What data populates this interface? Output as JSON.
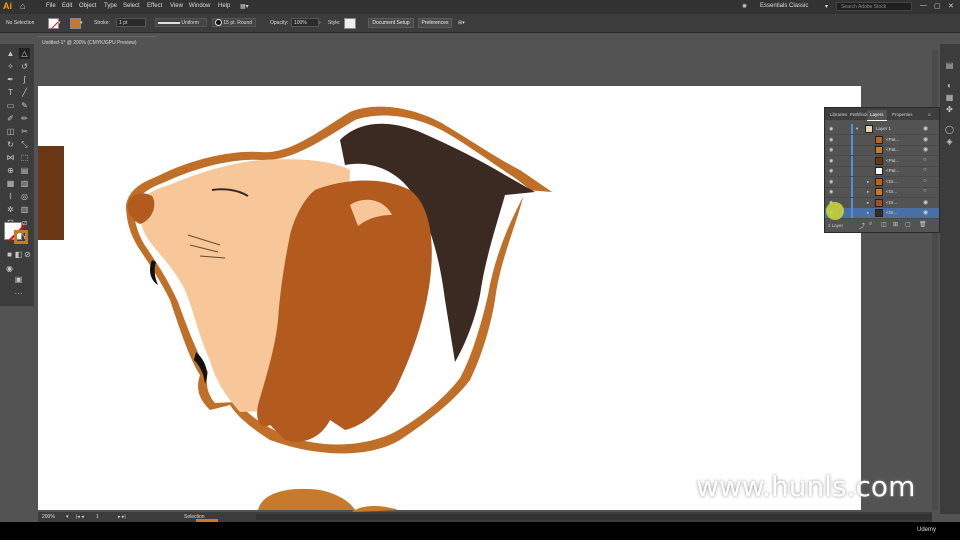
{
  "app": {
    "logo": "Ai",
    "home_icon": "home-icon"
  },
  "menu": [
    "File",
    "Edit",
    "Object",
    "Type",
    "Select",
    "Effect",
    "View",
    "Window",
    "Help"
  ],
  "workspace": "Essentials Classic",
  "search_placeholder": "Search Adobe Stock",
  "control": {
    "selection_label": "No Selection",
    "stroke_label": "Stroke:",
    "stroke_value": "1 pt",
    "profile_label": "Uniform",
    "brush_label": "15 pt. Round",
    "opacity_label": "Opacity:",
    "opacity_value": "100%",
    "style_label": "Style:",
    "doc_setup": "Document Setup",
    "preferences": "Preferences"
  },
  "doc_tab": "Untitled-1* @ 200% (CMYK/GPU Preview)",
  "layers_panel": {
    "tabs": [
      "Libraries",
      "Pathfinder",
      "Layers",
      "Properties"
    ],
    "active_tab": "Layers",
    "rows": [
      {
        "name": "Layer 1",
        "thumb": "#e8d0b0"
      },
      {
        "name": "<Pat...",
        "thumb": "#b7651f"
      },
      {
        "name": "<Pat...",
        "thumb": "#c77a2c"
      },
      {
        "name": "<Pat...",
        "thumb": "#6a3613"
      },
      {
        "name": "<Pat...",
        "thumb": "#ffffff"
      },
      {
        "name": "<Gr...",
        "thumb": "#b7651f"
      },
      {
        "name": "<Gr...",
        "thumb": "#c77a2c"
      },
      {
        "name": "<Gr...",
        "thumb": "#a0522d"
      },
      {
        "name": "<Gr...",
        "thumb": "#3b2a22"
      }
    ],
    "footer": "1 Layer"
  },
  "status": {
    "zoom": "200%",
    "page": "1",
    "tool": "Selection"
  },
  "watermark": "www.hunls.com",
  "udemy": "Udemy",
  "colors": {
    "mane_dark": "#3b2a22",
    "mane_orange": "#b35a1e",
    "outline": "#c06f28",
    "face": "#f7c79a",
    "swatch": "#6a3613"
  }
}
